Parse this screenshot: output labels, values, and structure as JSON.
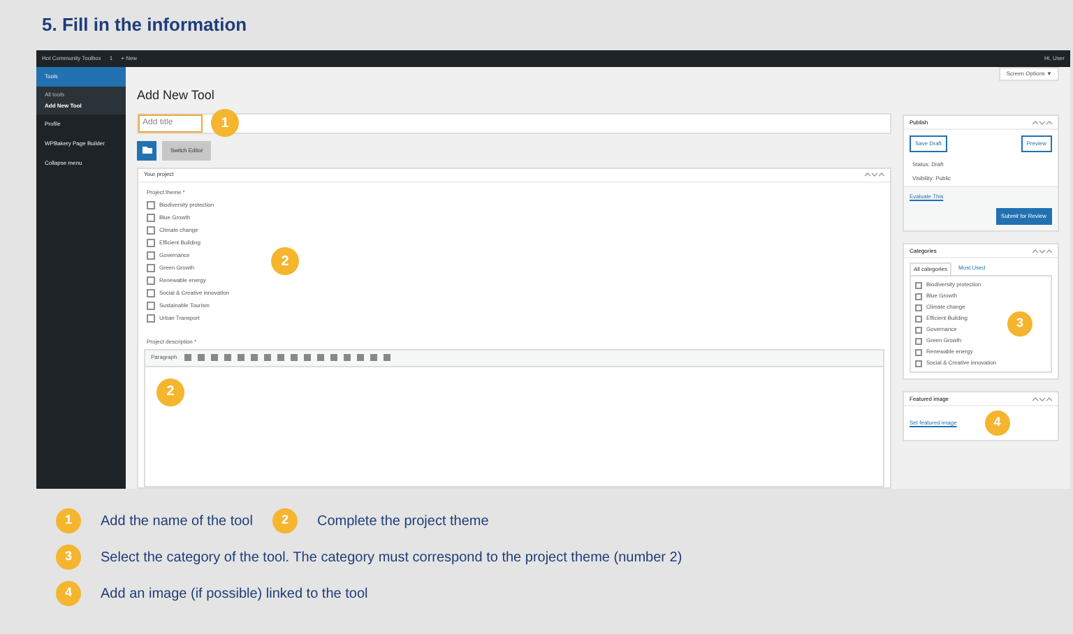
{
  "heading": "5. Fill in the information",
  "admin_bar": {
    "site": "Hot Community Toolbox",
    "items": [
      "1",
      "+ New"
    ],
    "user": "Hi, User"
  },
  "sidebar": {
    "items": [
      {
        "label": "Tools",
        "selected": true,
        "children": [
          {
            "label": "All tools",
            "selected": false
          },
          {
            "label": "Add New Tool",
            "selected": true
          }
        ]
      },
      {
        "label": "Profile",
        "selected": false
      },
      {
        "label": "WPBakery Page Builder",
        "selected": false
      },
      {
        "label": "Collapse menu",
        "selected": false
      }
    ]
  },
  "screen_options": "Screen Options ▼",
  "page_title": "Add New Tool",
  "title_field": {
    "placeholder": "Add title",
    "marker": "1"
  },
  "editor_switch": "Switch Editor",
  "project_box": {
    "title": "Your project",
    "theme_label": "Project theme *",
    "marker": "2",
    "themes": [
      {
        "label": "Biodiversity protection",
        "checked": false
      },
      {
        "label": "Blue Growth",
        "checked": false
      },
      {
        "label": "Climate change",
        "checked": false
      },
      {
        "label": "Efficient Building",
        "checked": false
      },
      {
        "label": "Governance",
        "checked": false
      },
      {
        "label": "Green Growth",
        "checked": false
      },
      {
        "label": "Renewable energy",
        "checked": false
      },
      {
        "label": "Social & Creative innovation",
        "checked": false
      },
      {
        "label": "Sustainable Tourism",
        "checked": false
      },
      {
        "label": "Urban Transport",
        "checked": false
      }
    ],
    "description_label": "Project description *",
    "format": "Paragraph",
    "editor_marker": "2"
  },
  "publish": {
    "title": "Publish",
    "save": "Save Draft",
    "preview": "Preview",
    "status": "Status: Draft",
    "visibility": "Visibility: Public",
    "link": "Evaluate This",
    "submit": "Submit for Review"
  },
  "categories": {
    "title": "Categories",
    "tabs": [
      {
        "label": "All categories",
        "selected": true
      },
      {
        "label": "Most Used",
        "selected": false
      }
    ],
    "marker": "3",
    "items": [
      {
        "label": "Biodiversity protection",
        "checked": false
      },
      {
        "label": "Blue Growth",
        "checked": false
      },
      {
        "label": "Climate change",
        "checked": false
      },
      {
        "label": "Efficient Building",
        "checked": false
      },
      {
        "label": "Governance",
        "checked": false
      },
      {
        "label": "Green Growth",
        "checked": false
      },
      {
        "label": "Renewable energy",
        "checked": false
      },
      {
        "label": "Social & Creative innovation",
        "checked": false
      }
    ]
  },
  "featured_image": {
    "title": "Featured image",
    "link": "Set featured image",
    "marker": "4"
  },
  "legend": [
    [
      {
        "number": "1",
        "text": "Add the name of the tool"
      },
      {
        "number": "2",
        "text": "Complete the project theme"
      }
    ],
    [
      {
        "number": "3",
        "text": "Select the category of the tool. The category must correspond to the project theme (number 2)"
      }
    ],
    [
      {
        "number": "4",
        "text": "Add an image (if possible) linked to the tool"
      }
    ]
  ]
}
